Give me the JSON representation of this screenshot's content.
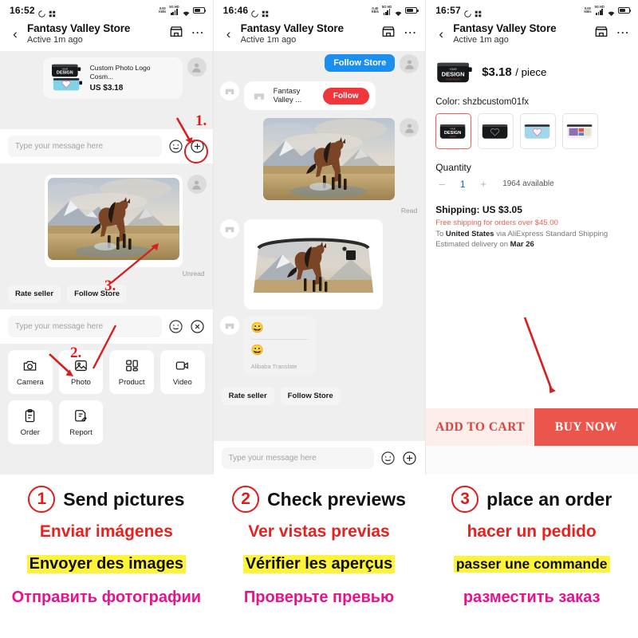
{
  "panels": [
    {
      "status": {
        "time": "16:52",
        "net_rate": "0.00",
        "net_unit": "KB/s",
        "net_type": "5G HD"
      },
      "header": {
        "title": "Fantasy Valley Store",
        "subtitle": "Active 1m ago",
        "back_icon": "back-chevron-icon",
        "store_icon": "storefront-icon",
        "more_icon": "more-dots-icon"
      },
      "product_card": {
        "title": "Custom Photo Logo Cosm...",
        "price": "US $3.18"
      },
      "image_meta": "Unread",
      "quick_actions": [
        "Rate seller",
        "Follow Store"
      ],
      "composer": {
        "placeholder": "Type your message here",
        "emoji_icon": "emoji-smiley-icon",
        "plus_icon": "plus-circle-icon",
        "close_icon": "close-circle-icon"
      },
      "attachments": [
        {
          "label": "Camera",
          "icon": "camera-icon"
        },
        {
          "label": "Photo",
          "icon": "photo-icon"
        },
        {
          "label": "Product",
          "icon": "product-grid-icon"
        },
        {
          "label": "Video",
          "icon": "video-camera-icon"
        },
        {
          "label": "Order",
          "icon": "clipboard-icon"
        },
        {
          "label": "Report",
          "icon": "report-icon"
        }
      ],
      "annotations": [
        "1.",
        "2.",
        "3."
      ]
    },
    {
      "status": {
        "time": "16:46",
        "net_rate": "0.40",
        "net_unit": "KB/s",
        "net_type": "5G HD"
      },
      "header": {
        "title": "Fantasy Valley Store",
        "subtitle": "Active 1m ago"
      },
      "follow_store_chip": "Follow Store",
      "store_card": {
        "name": "Fantasy Valley ...",
        "button": "Follow"
      },
      "image_meta": "Read",
      "translate_bubble": {
        "emoji_top": "😀",
        "emoji_bottom": "😀",
        "source": "Alibaba Translate"
      },
      "quick_actions": [
        "Rate seller",
        "Follow Store"
      ],
      "composer": {
        "placeholder": "Type your message here"
      }
    },
    {
      "status": {
        "time": "16:57",
        "net_rate": "0.00",
        "net_unit": "KB/s",
        "net_type": "5G HD"
      },
      "header": {
        "title": "Fantasy Valley Store",
        "subtitle": "Active 1m ago"
      },
      "price": "$3.18",
      "price_unit": "/ piece",
      "color_label": "Color: shzbcustom01fx",
      "swatch_count": 4,
      "selected_swatch": 0,
      "quantity_label": "Quantity",
      "qty_minus": "–",
      "qty_value": "1",
      "qty_plus": "+",
      "qty_available": "1964 available",
      "shipping_title": "Shipping: US $3.05",
      "shipping_free": "Free shipping for orders over $45.00",
      "shipping_to_prefix": "To ",
      "shipping_to_country": "United States",
      "shipping_to_suffix": " via AliExpress Standard Shipping",
      "shipping_eta_prefix": "Estimated delivery on ",
      "shipping_eta_date": "Mar 26",
      "cta_add": "ADD TO CART",
      "cta_buy": "BUY NOW"
    }
  ],
  "instructions": {
    "steps": [
      {
        "num": "①",
        "num_plain": "1",
        "english": "Send pictures",
        "spanish": "Enviar imágenes",
        "french": "Envoyer des images",
        "russian": "Отправить фотографии"
      },
      {
        "num": "②",
        "num_plain": "2",
        "english": "Check previews",
        "spanish": "Ver vistas previas",
        "french": "Vérifier les aperçus",
        "russian": "Проверьте превью"
      },
      {
        "num": "③",
        "num_plain": "3",
        "english": "place an order",
        "spanish": "hacer un pedido",
        "french": "passer une commande",
        "russian": "разместить заказ"
      }
    ]
  },
  "colors": {
    "annotation_red": "#e01b1b",
    "buy_now_red": "#ea564b",
    "add_cart_bg": "#fdeeec",
    "follow_blue": "#1b8ff0",
    "follow_red": "#f0353b",
    "highlight_yellow": "#fdf43a",
    "russian_magenta": "#e8128c"
  }
}
